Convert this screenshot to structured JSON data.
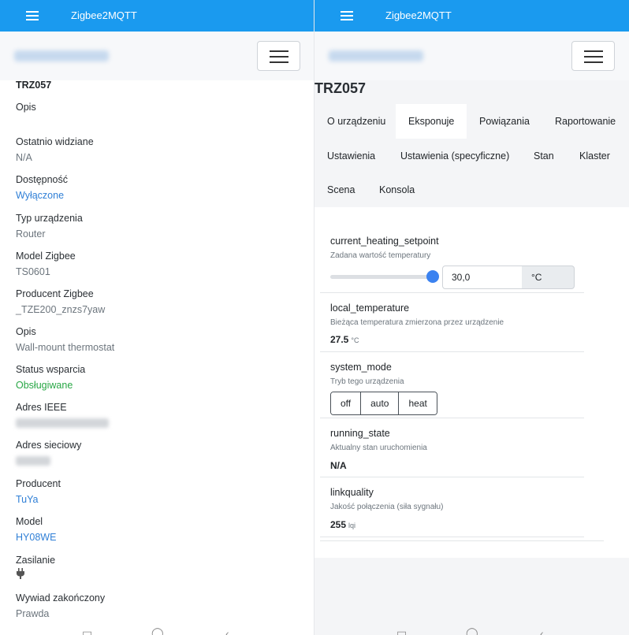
{
  "app": {
    "title": "Zigbee2MQTT"
  },
  "left": {
    "fields": [
      {
        "label": "TRZ057",
        "value": ""
      },
      {
        "label": "Opis",
        "value": ""
      },
      {
        "label": "Ostatnio widziane",
        "value": "N/A"
      },
      {
        "label": "Dostępność",
        "value": "Wyłączone"
      },
      {
        "label": "Typ urządzenia",
        "value": "Router"
      },
      {
        "label": "Model Zigbee",
        "value": "TS0601"
      },
      {
        "label": "Producent Zigbee",
        "value": "_TZE200_znzs7yaw"
      },
      {
        "label": "Opis",
        "value": "Wall-mount thermostat"
      },
      {
        "label": "Status wsparcia",
        "value": "Obsługiwane"
      },
      {
        "label": "Adres IEEE",
        "value": ""
      },
      {
        "label": "Adres sieciowy",
        "value": ""
      },
      {
        "label": "Producent",
        "value": "TuYa"
      },
      {
        "label": "Model",
        "value": "HY08WE"
      },
      {
        "label": "Zasilanie",
        "value": ""
      },
      {
        "label": "Wywiad zakończony",
        "value": "Prawda"
      }
    ]
  },
  "right": {
    "device_title": "TRZ057",
    "tabs": [
      {
        "label": "O urządzeniu"
      },
      {
        "label": "Eksponuje",
        "active": true
      },
      {
        "label": "Powiązania"
      },
      {
        "label": "Raportowanie"
      },
      {
        "label": "Ustawienia"
      },
      {
        "label": "Ustawienia (specyficzne)"
      },
      {
        "label": "Stan"
      },
      {
        "label": "Klaster"
      },
      {
        "label": "Scena"
      },
      {
        "label": "Konsola"
      }
    ],
    "features": {
      "setpoint": {
        "name": "current_heating_setpoint",
        "desc": "Zadana wartość temperatury",
        "value": "30,0",
        "unit": "°C",
        "slider_fraction": 1.0
      },
      "local_temp": {
        "name": "local_temperature",
        "desc": "Bieżąca temperatura zmierzona przez urządzenie",
        "value": "27.5",
        "unit": "°C"
      },
      "system_mode": {
        "name": "system_mode",
        "desc": "Tryb tego urządzenia",
        "options": [
          "off",
          "auto",
          "heat"
        ]
      },
      "running_state": {
        "name": "running_state",
        "desc": "Aktualny stan uruchomienia",
        "value": "N/A"
      },
      "linkquality": {
        "name": "linkquality",
        "desc": "Jakość połączenia (siła sygnału)",
        "value": "255",
        "unit": "lqi"
      }
    }
  },
  "colors": {
    "topbar": "#1a9aef",
    "link": "#2f7fd6",
    "success": "#28a745",
    "slider": "#3b82f0"
  }
}
